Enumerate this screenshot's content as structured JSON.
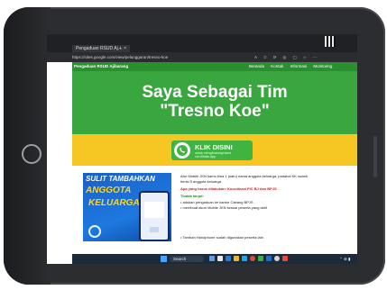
{
  "browser": {
    "tab_title": "Pengaduan RSUD Aj… ×",
    "tab_add": "+",
    "url": "https://sites.google.com/view/pelanggaran/tresno-koe",
    "url_icons": "A✩⟳◎▢☆⋯"
  },
  "site": {
    "title": "Pengaduan RSUD Ajibarang",
    "nav": [
      "Beranda",
      "Kontak",
      "Informasi",
      "Monitoring"
    ]
  },
  "hero": {
    "title_line1": "Saya Sebagai Tim",
    "title_line2": "\"Tresno Koe\"",
    "button_main": "KLIK DISINI",
    "button_sub1": "untuk menghubungi kami",
    "button_sub2": "via Whats App"
  },
  "ad": {
    "line1": "SULIT TAMBAHKAN",
    "line2": "ANGGOTA",
    "line3": "KELUARGA?"
  },
  "text": {
    "line1": "Atur Mobile JKN kamu bisa 1 (satu) nama anggota keluarga, padahal KK sudah",
    "line2": "berisi 5 anggota keluarga",
    "line3": "Apa yang harus dilakukan: Koordinasi PIC BJ dan BPJS",
    "line4": "Tindak lanjut:",
    "bullet1": "• adukan pengaduan ke kantor Cabang BPJS",
    "bullet2": "• membuat akun Mobile JKN sesuai peserta yang aktif",
    "bullet3": "• Tambah Handphone sudah digunakan peserta lain"
  },
  "taskbar": {
    "search_label": "Search",
    "tray": "⌃ ⊕ ▮"
  },
  "colors": {
    "tablet": "#2c2d30",
    "hero_green": "#3aa640",
    "banner_yellow": "#f6c623",
    "whatsapp_green": "#3fb441",
    "nav_green": "#2a8f2f"
  }
}
